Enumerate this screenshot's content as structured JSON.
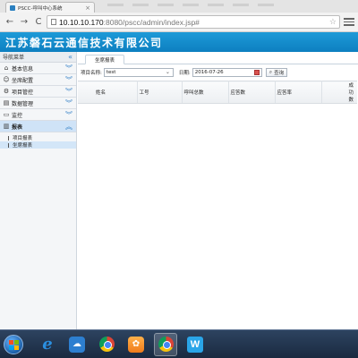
{
  "browser": {
    "tab_title": "PSCC-呼叫中心系统",
    "url_host": "10.10.10.170",
    "url_rest": ":8080/pscc/admin/index.jsp#"
  },
  "app": {
    "company_name": "江苏磐石云通信技术有限公司",
    "header_color": "#1590d0"
  },
  "sidebar": {
    "title": "导航菜单",
    "items": [
      {
        "label": "基本信息",
        "icon": "home-icon"
      },
      {
        "label": "坐席配置",
        "icon": "agent-icon"
      },
      {
        "label": "项目管控",
        "icon": "settings-icon"
      },
      {
        "label": "数据管理",
        "icon": "data-icon"
      },
      {
        "label": "监控",
        "icon": "monitor-icon"
      },
      {
        "label": "报表",
        "icon": "chart-icon"
      }
    ],
    "sub_items": [
      {
        "label": "项目报表"
      },
      {
        "label": "坐席报表"
      }
    ]
  },
  "main": {
    "active_tab": "坐席报表",
    "filters": {
      "project_label": "项目名称:",
      "project_value": "test",
      "date_label": "日期:",
      "date_value": "2016-07-26",
      "search_label": "查询"
    },
    "table": {
      "columns": [
        "姓名",
        "工号",
        "呼叫总数",
        "应答数",
        "应答率",
        "成功数"
      ],
      "rows": []
    }
  },
  "taskbar": {
    "apps": [
      "start-button",
      "ie-icon",
      "cloud-icon",
      "chrome-icon",
      "orange-app-icon",
      "chrome-active-icon",
      "w-app-icon"
    ]
  }
}
